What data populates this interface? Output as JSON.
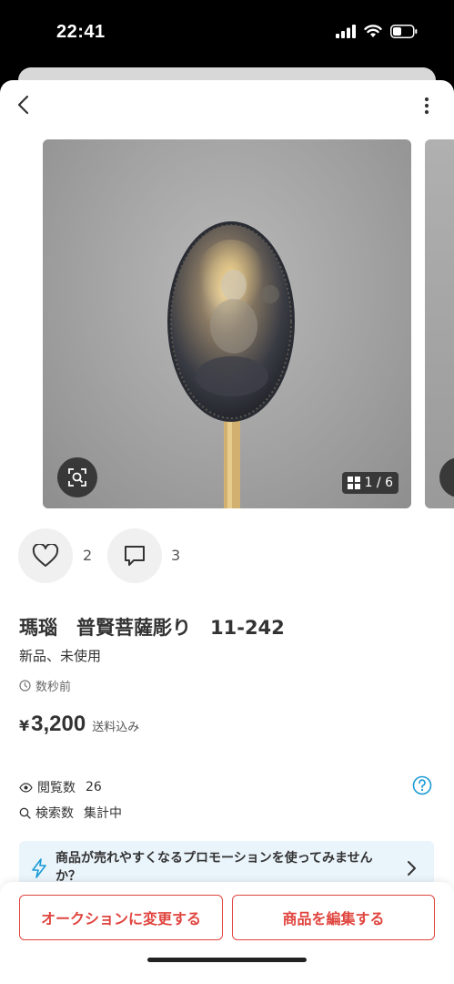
{
  "status_bar": {
    "time": "22:41"
  },
  "listing": {
    "title": "瑪瑙　普賢菩薩彫り　11-242",
    "condition": "新品、未使用",
    "posted": "数秒前",
    "price_symbol": "¥",
    "price": "3,200",
    "shipping": "送料込み"
  },
  "gallery": {
    "counter": "1 / 6"
  },
  "actions": {
    "like_count": "2",
    "comment_count": "3"
  },
  "stats": {
    "views_label": "閲覧数",
    "views_value": "26",
    "searches_label": "検索数",
    "searches_value": "集計中"
  },
  "promo": {
    "text": "商品が売れやすくなるプロモーションを使ってみませんか？"
  },
  "footer": {
    "auction_label": "オークションに変更する",
    "edit_label": "商品を編集する"
  },
  "colors": {
    "accent": "#e0453f",
    "help": "#1a9ad6",
    "promo_bg": "#eaf4fb"
  }
}
